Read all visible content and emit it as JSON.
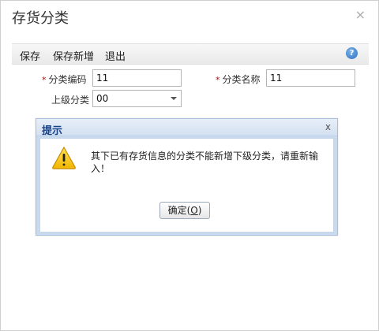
{
  "window": {
    "title": "存货分类",
    "close_glyph": "×"
  },
  "toolbar": {
    "save_label": "保存",
    "save_new_label": "保存新增",
    "exit_label": "退出",
    "help_glyph": "?"
  },
  "form": {
    "required_mark": "*",
    "category_code_label": "分类编码",
    "category_code_value": "11",
    "category_name_label": "分类名称",
    "category_name_value": "11",
    "parent_category_label": "上级分类",
    "parent_category_value": "00"
  },
  "dialog": {
    "title": "提示",
    "close_glyph": "x",
    "message": "其下已有存货信息的分类不能新增下级分类，请重新输入！",
    "ok_label_prefix": "确定(",
    "ok_label_key": "O",
    "ok_label_suffix": ")",
    "icon": "warning-icon"
  },
  "colors": {
    "dialog_title_text": "#15428b",
    "required_star": "#cc0000",
    "warning_fill": "#f5c400"
  }
}
